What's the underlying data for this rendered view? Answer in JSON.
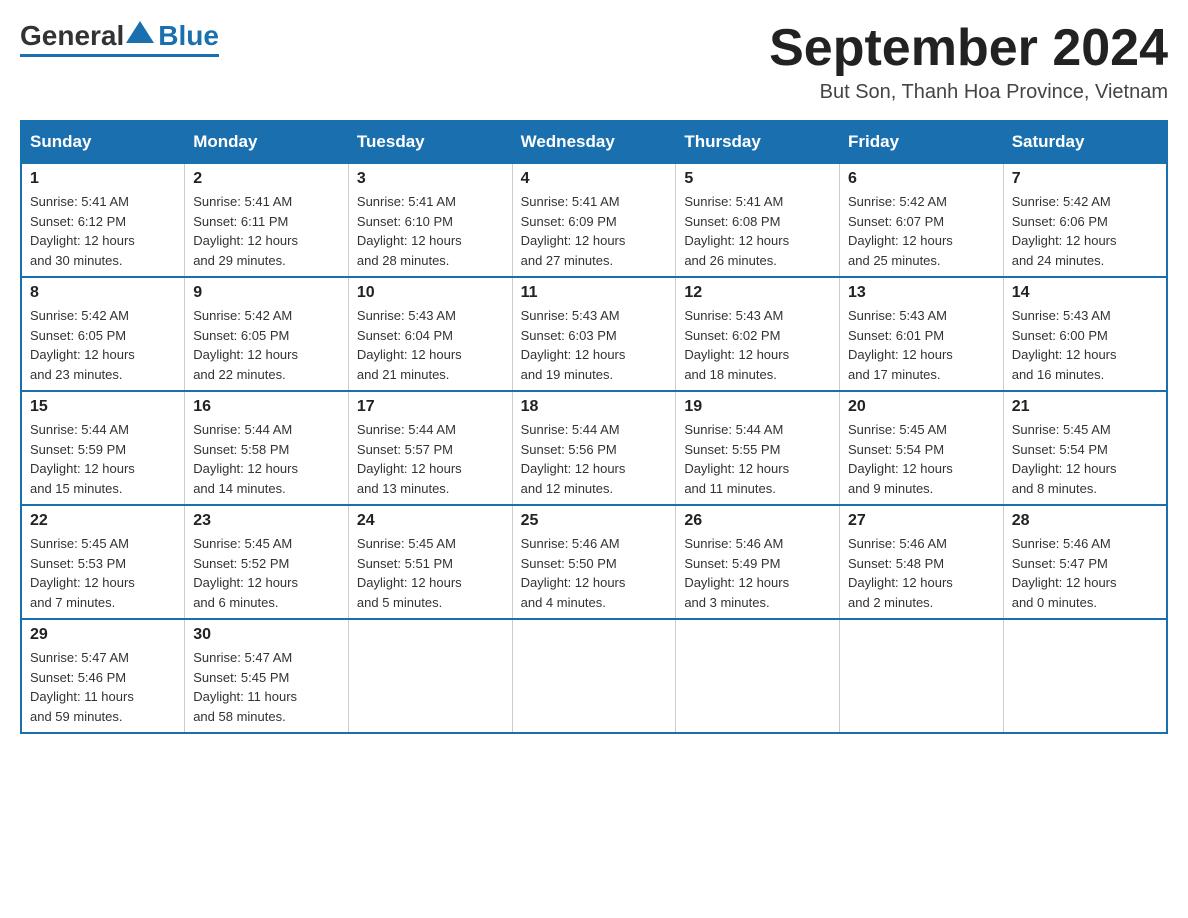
{
  "logo": {
    "general": "General",
    "blue": "Blue"
  },
  "header": {
    "month_year": "September 2024",
    "location": "But Son, Thanh Hoa Province, Vietnam"
  },
  "days_of_week": [
    "Sunday",
    "Monday",
    "Tuesday",
    "Wednesday",
    "Thursday",
    "Friday",
    "Saturday"
  ],
  "weeks": [
    [
      {
        "day": "1",
        "sunrise": "5:41 AM",
        "sunset": "6:12 PM",
        "daylight": "12 hours and 30 minutes."
      },
      {
        "day": "2",
        "sunrise": "5:41 AM",
        "sunset": "6:11 PM",
        "daylight": "12 hours and 29 minutes."
      },
      {
        "day": "3",
        "sunrise": "5:41 AM",
        "sunset": "6:10 PM",
        "daylight": "12 hours and 28 minutes."
      },
      {
        "day": "4",
        "sunrise": "5:41 AM",
        "sunset": "6:09 PM",
        "daylight": "12 hours and 27 minutes."
      },
      {
        "day": "5",
        "sunrise": "5:41 AM",
        "sunset": "6:08 PM",
        "daylight": "12 hours and 26 minutes."
      },
      {
        "day": "6",
        "sunrise": "5:42 AM",
        "sunset": "6:07 PM",
        "daylight": "12 hours and 25 minutes."
      },
      {
        "day": "7",
        "sunrise": "5:42 AM",
        "sunset": "6:06 PM",
        "daylight": "12 hours and 24 minutes."
      }
    ],
    [
      {
        "day": "8",
        "sunrise": "5:42 AM",
        "sunset": "6:05 PM",
        "daylight": "12 hours and 23 minutes."
      },
      {
        "day": "9",
        "sunrise": "5:42 AM",
        "sunset": "6:05 PM",
        "daylight": "12 hours and 22 minutes."
      },
      {
        "day": "10",
        "sunrise": "5:43 AM",
        "sunset": "6:04 PM",
        "daylight": "12 hours and 21 minutes."
      },
      {
        "day": "11",
        "sunrise": "5:43 AM",
        "sunset": "6:03 PM",
        "daylight": "12 hours and 19 minutes."
      },
      {
        "day": "12",
        "sunrise": "5:43 AM",
        "sunset": "6:02 PM",
        "daylight": "12 hours and 18 minutes."
      },
      {
        "day": "13",
        "sunrise": "5:43 AM",
        "sunset": "6:01 PM",
        "daylight": "12 hours and 17 minutes."
      },
      {
        "day": "14",
        "sunrise": "5:43 AM",
        "sunset": "6:00 PM",
        "daylight": "12 hours and 16 minutes."
      }
    ],
    [
      {
        "day": "15",
        "sunrise": "5:44 AM",
        "sunset": "5:59 PM",
        "daylight": "12 hours and 15 minutes."
      },
      {
        "day": "16",
        "sunrise": "5:44 AM",
        "sunset": "5:58 PM",
        "daylight": "12 hours and 14 minutes."
      },
      {
        "day": "17",
        "sunrise": "5:44 AM",
        "sunset": "5:57 PM",
        "daylight": "12 hours and 13 minutes."
      },
      {
        "day": "18",
        "sunrise": "5:44 AM",
        "sunset": "5:56 PM",
        "daylight": "12 hours and 12 minutes."
      },
      {
        "day": "19",
        "sunrise": "5:44 AM",
        "sunset": "5:55 PM",
        "daylight": "12 hours and 11 minutes."
      },
      {
        "day": "20",
        "sunrise": "5:45 AM",
        "sunset": "5:54 PM",
        "daylight": "12 hours and 9 minutes."
      },
      {
        "day": "21",
        "sunrise": "5:45 AM",
        "sunset": "5:54 PM",
        "daylight": "12 hours and 8 minutes."
      }
    ],
    [
      {
        "day": "22",
        "sunrise": "5:45 AM",
        "sunset": "5:53 PM",
        "daylight": "12 hours and 7 minutes."
      },
      {
        "day": "23",
        "sunrise": "5:45 AM",
        "sunset": "5:52 PM",
        "daylight": "12 hours and 6 minutes."
      },
      {
        "day": "24",
        "sunrise": "5:45 AM",
        "sunset": "5:51 PM",
        "daylight": "12 hours and 5 minutes."
      },
      {
        "day": "25",
        "sunrise": "5:46 AM",
        "sunset": "5:50 PM",
        "daylight": "12 hours and 4 minutes."
      },
      {
        "day": "26",
        "sunrise": "5:46 AM",
        "sunset": "5:49 PM",
        "daylight": "12 hours and 3 minutes."
      },
      {
        "day": "27",
        "sunrise": "5:46 AM",
        "sunset": "5:48 PM",
        "daylight": "12 hours and 2 minutes."
      },
      {
        "day": "28",
        "sunrise": "5:46 AM",
        "sunset": "5:47 PM",
        "daylight": "12 hours and 0 minutes."
      }
    ],
    [
      {
        "day": "29",
        "sunrise": "5:47 AM",
        "sunset": "5:46 PM",
        "daylight": "11 hours and 59 minutes."
      },
      {
        "day": "30",
        "sunrise": "5:47 AM",
        "sunset": "5:45 PM",
        "daylight": "11 hours and 58 minutes."
      },
      null,
      null,
      null,
      null,
      null
    ]
  ],
  "labels": {
    "sunrise": "Sunrise:",
    "sunset": "Sunset:",
    "daylight": "Daylight:"
  }
}
